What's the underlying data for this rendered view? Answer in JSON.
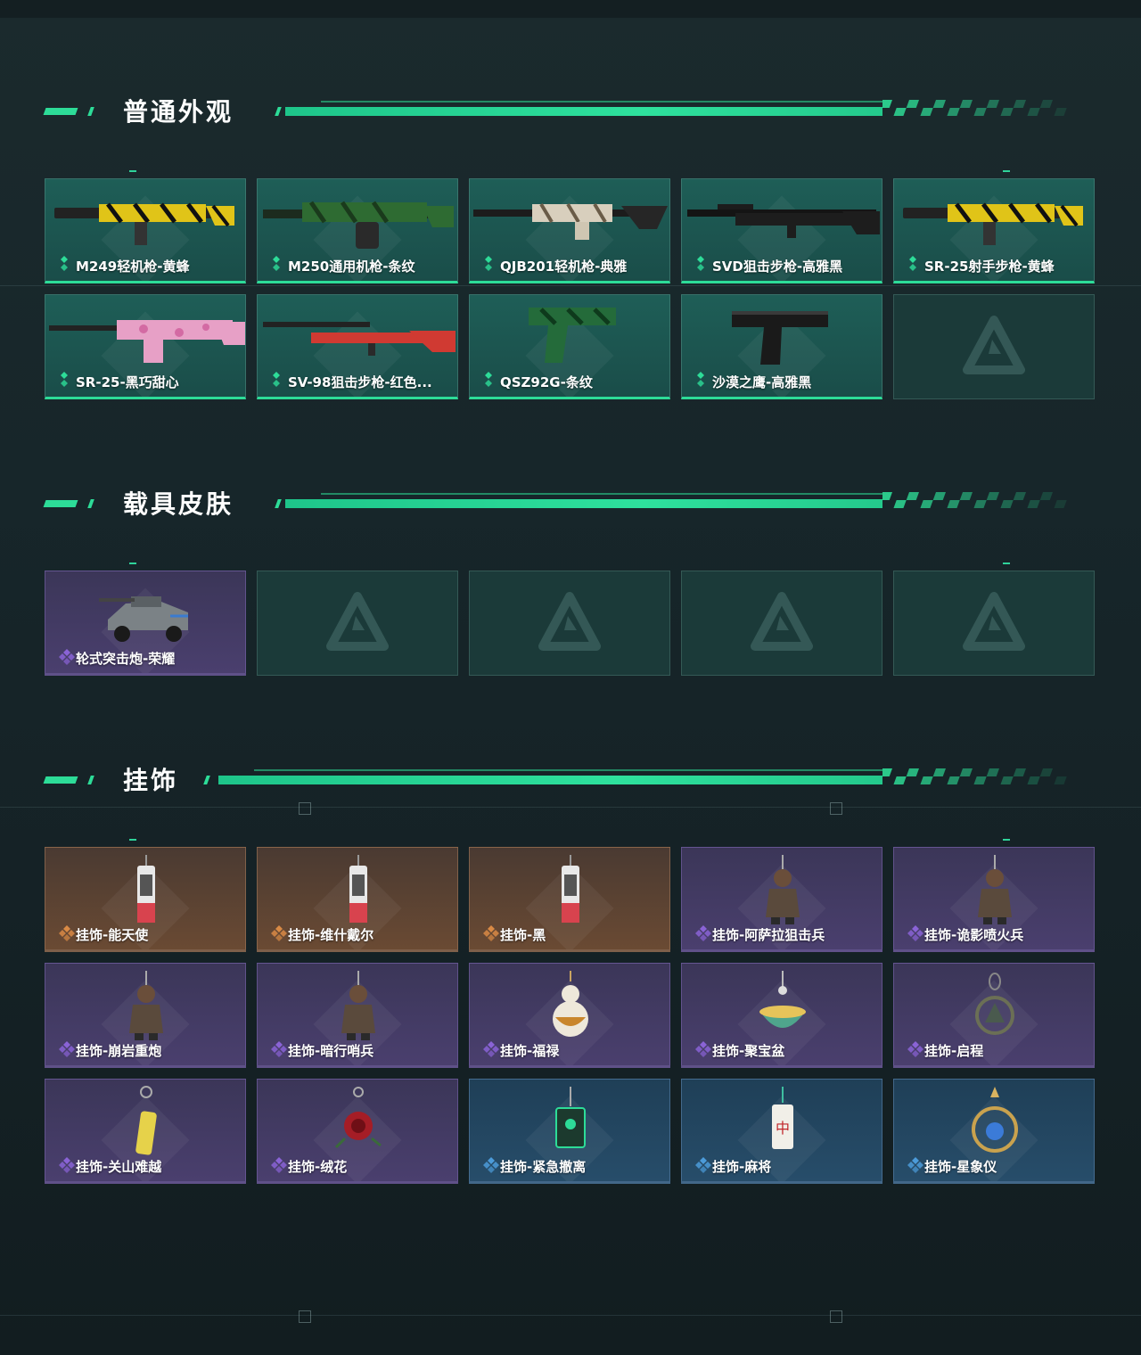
{
  "sections": [
    {
      "title": "普通外观",
      "items": [
        {
          "label": "M249轻机枪-黄蜂",
          "rarity": "green",
          "art": "rifle-yellow-icon"
        },
        {
          "label": "M250通用机枪-条纹",
          "rarity": "green",
          "art": "mg-green-icon"
        },
        {
          "label": "QJB201轻机枪-典雅",
          "rarity": "green",
          "art": "mg-white-icon"
        },
        {
          "label": "SVD狙击步枪-高雅黑",
          "rarity": "green",
          "art": "sniper-black-icon"
        },
        {
          "label": "SR-25射手步枪-黄蜂",
          "rarity": "green",
          "art": "dmr-yellow-icon"
        },
        {
          "label": "SR-25-黑巧甜心",
          "rarity": "green",
          "art": "dmr-pink-icon"
        },
        {
          "label": "SV-98狙击步枪-红色...",
          "rarity": "green",
          "art": "sniper-red-icon"
        },
        {
          "label": "QSZ92G-条纹",
          "rarity": "green",
          "art": "pistol-green-icon"
        },
        {
          "label": "沙漠之鹰-高雅黑",
          "rarity": "green",
          "art": "pistol-black-icon"
        },
        {
          "label": "",
          "rarity": "empty",
          "art": "logo-icon"
        }
      ]
    },
    {
      "title": "载具皮肤",
      "items": [
        {
          "label": "轮式突击炮-荣耀",
          "rarity": "purple",
          "art": "vehicle-icon"
        },
        {
          "label": "",
          "rarity": "empty",
          "art": "logo-icon"
        },
        {
          "label": "",
          "rarity": "empty",
          "art": "logo-icon"
        },
        {
          "label": "",
          "rarity": "empty",
          "art": "logo-icon"
        },
        {
          "label": "",
          "rarity": "empty",
          "art": "logo-icon"
        }
      ]
    },
    {
      "title": "挂饰",
      "items": [
        {
          "label": "挂饰-能天使",
          "rarity": "orange",
          "art": "charm-can-icon"
        },
        {
          "label": "挂饰-维什戴尔",
          "rarity": "orange",
          "art": "charm-can-icon"
        },
        {
          "label": "挂饰-黑",
          "rarity": "orange",
          "art": "charm-can-icon"
        },
        {
          "label": "挂饰-阿萨拉狙击兵",
          "rarity": "purple",
          "art": "charm-figure-icon"
        },
        {
          "label": "挂饰-诡影喷火兵",
          "rarity": "purple",
          "art": "charm-figure-icon"
        },
        {
          "label": "挂饰-崩岩重炮",
          "rarity": "purple",
          "art": "charm-figure-icon"
        },
        {
          "label": "挂饰-暗行哨兵",
          "rarity": "purple",
          "art": "charm-figure-icon"
        },
        {
          "label": "挂饰-福禄",
          "rarity": "purple",
          "art": "charm-gourd-icon"
        },
        {
          "label": "挂饰-聚宝盆",
          "rarity": "purple",
          "art": "charm-bowl-icon"
        },
        {
          "label": "挂饰-启程",
          "rarity": "purple",
          "art": "charm-ring-icon"
        },
        {
          "label": "挂饰-关山难越",
          "rarity": "purple",
          "art": "charm-bar-icon"
        },
        {
          "label": "挂饰-绒花",
          "rarity": "purple",
          "art": "charm-rose-icon"
        },
        {
          "label": "挂饰-紧急撤离",
          "rarity": "blue",
          "art": "charm-sign-icon"
        },
        {
          "label": "挂饰-麻将",
          "rarity": "blue",
          "art": "charm-mahjong-icon"
        },
        {
          "label": "挂饰-星象仪",
          "rarity": "blue",
          "art": "charm-astrolabe-icon"
        }
      ]
    }
  ],
  "colors": {
    "accent": "#2ddc98",
    "green_rarity": "#2ddc98",
    "purple_rarity": "#8a63d6",
    "orange_rarity": "#d98a45",
    "blue_rarity": "#4c9bd9"
  }
}
